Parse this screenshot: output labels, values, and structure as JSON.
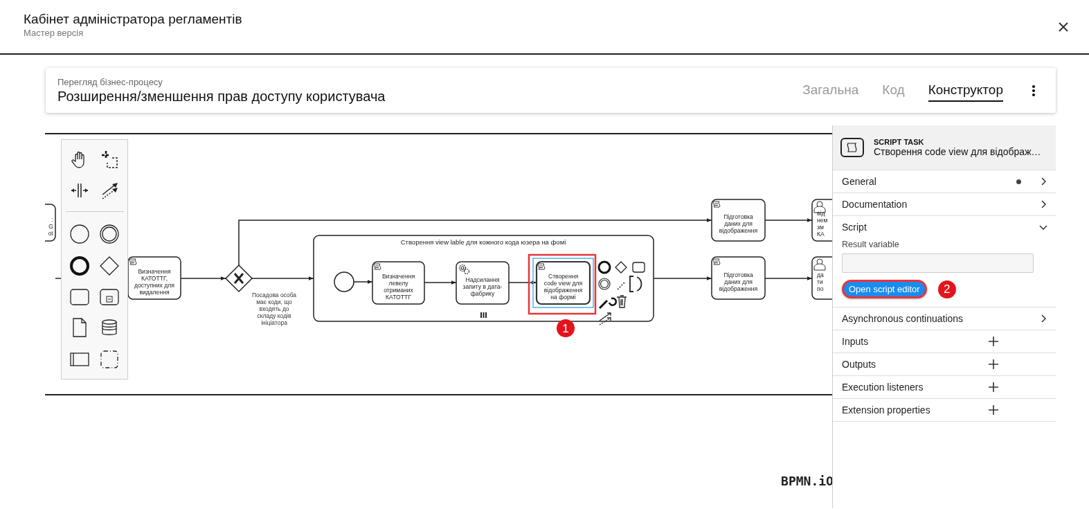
{
  "header": {
    "title": "Кабінет адміністратора регламентів",
    "subtitle": "Мастер версія"
  },
  "process_card": {
    "caption": "Перегляд бізнес-процесу",
    "title": "Розширення/зменшення прав доступу користувача",
    "tabs": [
      {
        "label": "Загальна",
        "selected": false
      },
      {
        "label": "Код",
        "selected": false
      },
      {
        "label": "Конструктор",
        "selected": true
      }
    ]
  },
  "diagram": {
    "tasks": [
      {
        "kind": "none",
        "lines": [
          ":",
          "G",
          "ої"
        ],
        "selected": false
      },
      {
        "kind": "script",
        "lines": [
          "Визначення",
          "КАТОТТГ,",
          "доступних для",
          "видалення"
        ],
        "selected": false
      },
      {
        "kind": "script",
        "lines": [
          "Визначення",
          "левелу",
          "отриманих",
          "КАТОТТГ"
        ],
        "selected": false
      },
      {
        "kind": "service",
        "lines": [
          "Надсилання",
          "запиту в дата-",
          "фабрику"
        ],
        "selected": false
      },
      {
        "kind": "script",
        "lines": [
          "Створення",
          "code view для",
          "відображення",
          "на формі"
        ],
        "selected": true
      },
      {
        "kind": "script",
        "lines": [
          "Підготовка",
          "даних для",
          "відображення"
        ],
        "selected": false
      },
      {
        "kind": "script",
        "lines": [
          "Підготовка",
          "даних для",
          "відображення"
        ],
        "selected": false
      },
      {
        "kind": "user",
        "lines": [
          "від",
          "нем",
          "зм",
          "КА"
        ],
        "selected": false
      },
      {
        "kind": "user",
        "lines": [
          "да",
          "ти",
          "по"
        ],
        "selected": false
      }
    ],
    "gateway_label": [
      "Посадова особа",
      "має коди, що",
      "входять до",
      "складу кодів",
      "ініціатора"
    ],
    "subprocess_title": "Створення view lable для кожного кода юзера на фомі",
    "step_badge": "1",
    "watermark": "BPMN.iO"
  },
  "properties": {
    "type": "SCRIPT TASK",
    "name": "Створення code view для відображ…",
    "sections": [
      {
        "label": "General",
        "kind": "chevron",
        "dot": true,
        "expanded": false
      },
      {
        "label": "Documentation",
        "kind": "chevron",
        "dot": false,
        "expanded": false
      },
      {
        "label": "Script",
        "kind": "chevron",
        "dot": false,
        "expanded": true,
        "field_label": "Result variable",
        "button": "Open script editor",
        "step_badge": "2"
      },
      {
        "label": "Asynchronous continuations",
        "kind": "chevron",
        "dot": false,
        "expanded": false
      },
      {
        "label": "Inputs",
        "kind": "plus",
        "dot": false,
        "expanded": false
      },
      {
        "label": "Outputs",
        "kind": "plus",
        "dot": false,
        "expanded": false
      },
      {
        "label": "Execution listeners",
        "kind": "plus",
        "dot": false,
        "expanded": false
      },
      {
        "label": "Extension properties",
        "kind": "plus",
        "dot": false,
        "expanded": false
      }
    ]
  }
}
